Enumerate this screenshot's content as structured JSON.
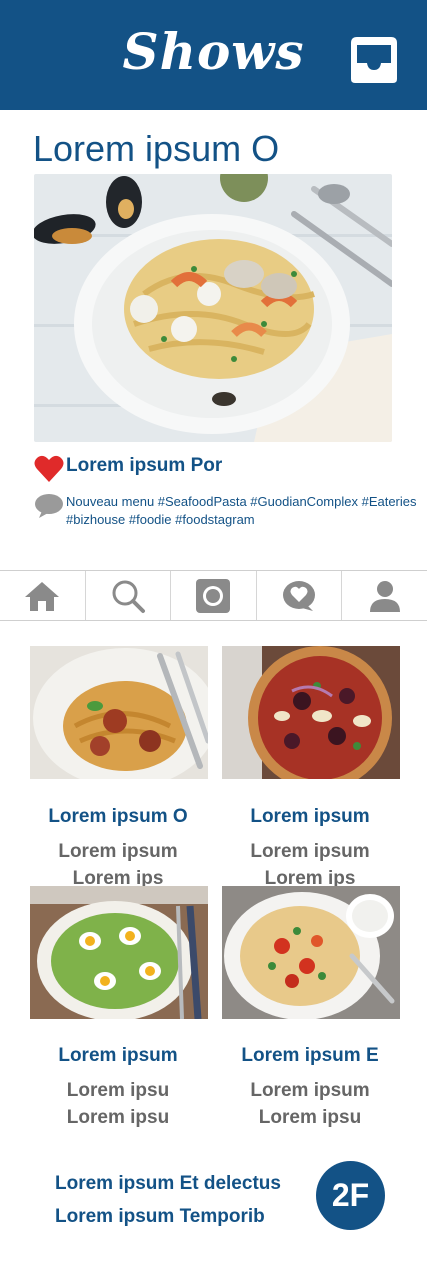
{
  "header": {
    "brand": "Shows",
    "inbox_icon": "inbox-tray-icon",
    "background": "#135286"
  },
  "post": {
    "title": "Lorem ipsum O",
    "image": "seafood-pasta-photo",
    "like_icon": "heart-icon",
    "author": "Lorem ipsum Por",
    "comment_icon": "speech-bubble-icon",
    "caption": "Nouveau menu #SeafoodPasta #GuodianComplex #Eateries #bizhouse #foodie #foodstagram"
  },
  "nav": {
    "items": [
      {
        "icon": "home-icon"
      },
      {
        "icon": "search-icon"
      },
      {
        "icon": "camera-icon"
      },
      {
        "icon": "heart-chat-icon"
      },
      {
        "icon": "profile-icon"
      }
    ]
  },
  "grid": {
    "cards": [
      {
        "image": "spaghetti-meatballs-photo",
        "title": "Lorem ipsum O",
        "line1": "Lorem ipsum",
        "line2": "Lorem ips"
      },
      {
        "image": "pizza-photo",
        "title": "Lorem ipsum",
        "line1": "Lorem ipsum",
        "line2": "Lorem ips"
      },
      {
        "image": "egg-salad-photo",
        "title": "Lorem ipsum",
        "line1": "Lorem ipsu",
        "line2": "Lorem ipsu"
      },
      {
        "image": "flatbread-photo",
        "title": "Lorem ipsum E",
        "line1": "Lorem ipsum",
        "line2": "Lorem ipsu"
      }
    ]
  },
  "footer": {
    "line1": "Lorem ipsum Et delectus",
    "line2": "Lorem ipsum Temporib",
    "badge": "2F"
  },
  "colors": {
    "accent": "#135286",
    "muted_text": "#666666",
    "divider": "#cfcfcf"
  }
}
